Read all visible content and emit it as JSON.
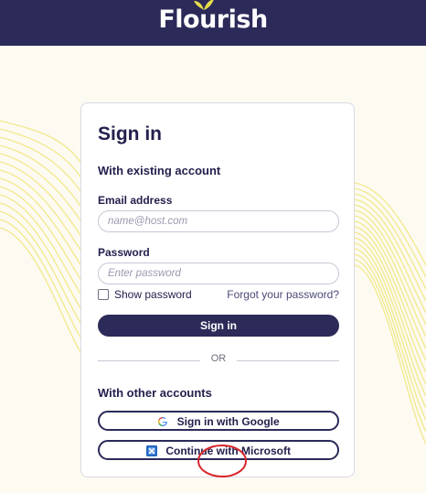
{
  "header": {
    "logo_text": "Flourish"
  },
  "signin": {
    "title": "Sign in",
    "subtitle": "With existing account",
    "email_label": "Email address",
    "email_placeholder": "name@host.com",
    "password_label": "Password",
    "password_placeholder": "Enter password",
    "show_password_label": "Show password",
    "forgot_password": "Forgot your password?",
    "signin_button": "Sign in",
    "or_text": "OR",
    "other_accounts": "With other accounts",
    "google_button": "Sign in with Google",
    "microsoft_button": "Continue with Microsoft"
  },
  "colors": {
    "brand_dark": "#2b2a58",
    "background": "#fdfaf2",
    "wave_lines": "#f1e98a",
    "annotation": "#d8262c"
  },
  "icons": [
    "leaf-icon",
    "google-icon",
    "microsoft-icon"
  ]
}
